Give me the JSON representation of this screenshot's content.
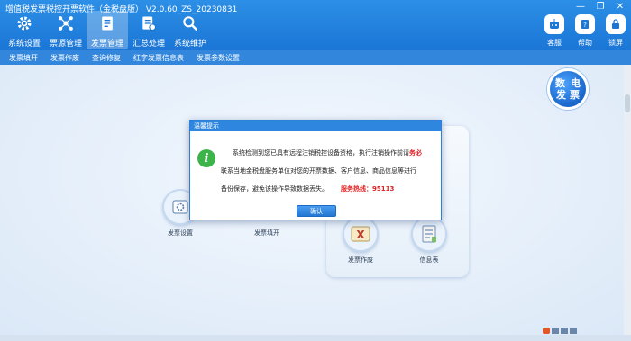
{
  "window": {
    "title": "增值税发票税控开票软件（金税盘版） V2.0.60_ZS_20230831",
    "controls": [
      "minimize",
      "restore",
      "close"
    ]
  },
  "nav": [
    {
      "key": "system-settings",
      "label": "系统设置",
      "icon": "gear-icon"
    },
    {
      "key": "bill-management",
      "label": "票源管理",
      "icon": "share-icon"
    },
    {
      "key": "invoice-management",
      "label": "发票管理",
      "icon": "document-icon",
      "active": true
    },
    {
      "key": "summary",
      "label": "汇总处理",
      "icon": "summary-doc-icon"
    },
    {
      "key": "system-maintenance",
      "label": "系统维护",
      "icon": "maintenance-icon"
    }
  ],
  "right_tools": [
    {
      "key": "ai",
      "label": "客服",
      "icon": "robot-icon"
    },
    {
      "key": "help",
      "label": "帮助",
      "icon": "help-icon"
    },
    {
      "key": "lock",
      "label": "锁屏",
      "icon": "lock-icon"
    }
  ],
  "submenu": [
    "发票填开",
    "发票作废",
    "查询修复",
    "红字发票信息表",
    "发票参数设置"
  ],
  "brand": {
    "line1": "数电",
    "line2": "发票"
  },
  "functions": [
    {
      "key": "invoice-settings",
      "label": "发票设置"
    },
    {
      "key": "invoice-fill",
      "label": "发票填开"
    },
    {
      "key": "invoice-void",
      "label": "发票作废"
    },
    {
      "key": "info-table",
      "label": "信息表"
    }
  ],
  "dialog": {
    "title": "温馨提示",
    "line1_prefix": "系统检测到您已具有远程注销税控设备资格，执行注销操作前请",
    "line1_emph": "务必",
    "line2": "联系当地金税盘服务单位对您的开票数据、客户信息、商品信息等进行",
    "line3": "备份保存，避免该操作导致数据丢失。",
    "hotline": "服务热线：95113",
    "ok_label": "确认"
  },
  "colors": {
    "accent": "#1b76d6",
    "emphasis": "#e02020",
    "info_green": "#3cb44a"
  }
}
